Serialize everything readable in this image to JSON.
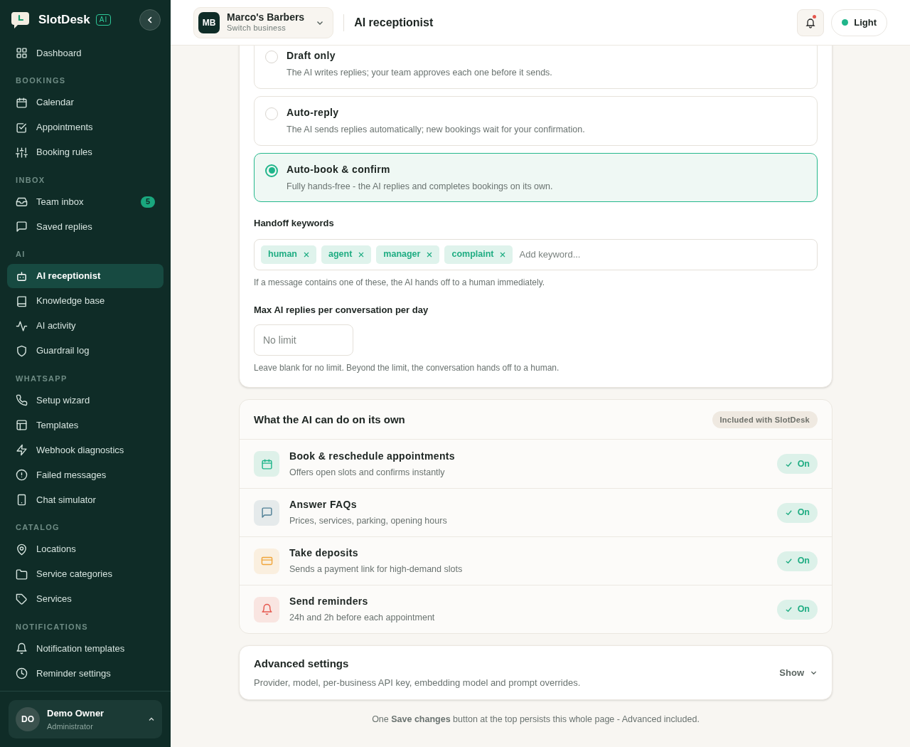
{
  "brand": {
    "name": "SlotDesk",
    "badge": "AI"
  },
  "sidebar": {
    "items": [
      {
        "label": "Dashboard",
        "kind": "grid",
        "selected": false
      }
    ],
    "sections": [
      {
        "title": "BOOKINGS",
        "items": [
          {
            "label": "Calendar",
            "kind": "calendar",
            "selected": false
          },
          {
            "label": "Appointments",
            "kind": "check",
            "selected": false
          },
          {
            "label": "Booking rules",
            "kind": "sliders",
            "selected": false
          }
        ]
      },
      {
        "title": "INBOX",
        "items": [
          {
            "label": "Team inbox",
            "kind": "inbox",
            "selected": false,
            "badge": "5"
          },
          {
            "label": "Saved replies",
            "kind": "chat",
            "selected": false
          }
        ]
      },
      {
        "title": "AI",
        "items": [
          {
            "label": "AI receptionist",
            "kind": "bot",
            "selected": true
          },
          {
            "label": "Knowledge base",
            "kind": "book",
            "selected": false
          },
          {
            "label": "AI activity",
            "kind": "pulse",
            "selected": false
          },
          {
            "label": "Guardrail log",
            "kind": "shield",
            "selected": false
          }
        ]
      },
      {
        "title": "WHATSAPP",
        "items": [
          {
            "label": "Setup wizard",
            "kind": "phone",
            "selected": false
          },
          {
            "label": "Templates",
            "kind": "layout",
            "selected": false
          },
          {
            "label": "Webhook diagnostics",
            "kind": "bolt",
            "selected": false
          },
          {
            "label": "Failed messages",
            "kind": "alert",
            "selected": false
          },
          {
            "label": "Chat simulator",
            "kind": "mobile",
            "selected": false
          }
        ]
      },
      {
        "title": "CATALOG",
        "items": [
          {
            "label": "Locations",
            "kind": "pin",
            "selected": false
          },
          {
            "label": "Service categories",
            "kind": "folder",
            "selected": false
          },
          {
            "label": "Services",
            "kind": "tag",
            "selected": false
          }
        ]
      },
      {
        "title": "NOTIFICATIONS",
        "items": [
          {
            "label": "Notification templates",
            "kind": "bell",
            "selected": false
          },
          {
            "label": "Reminder settings",
            "kind": "clock",
            "selected": false
          }
        ]
      }
    ],
    "user": {
      "initials": "DO",
      "name": "Demo Owner",
      "role": "Administrator"
    }
  },
  "header": {
    "business": {
      "initials": "MB",
      "name": "Marco's Barbers",
      "subtitle": "Switch business"
    },
    "title": "AI receptionist",
    "notifications_unread": true,
    "theme": "Light"
  },
  "modes": [
    {
      "title": "Draft only",
      "description": "The AI writes replies; your team approves each one before it sends.",
      "selected": false
    },
    {
      "title": "Auto-reply",
      "description": "The AI sends replies automatically; new bookings wait for your confirmation.",
      "selected": false
    },
    {
      "title": "Auto-book & confirm",
      "description": "Fully hands-free - the AI replies and completes bookings on its own.",
      "selected": true
    }
  ],
  "handoff": {
    "label": "Handoff keywords",
    "keywords": [
      "human",
      "agent",
      "manager",
      "complaint"
    ],
    "placeholder": "Add keyword...",
    "help": "If a message contains one of these, the AI hands off to a human immediately."
  },
  "max_replies": {
    "label": "Max AI replies per conversation per day",
    "placeholder": "No limit",
    "help": "Leave blank for no limit. Beyond the limit, the conversation hands off to a human."
  },
  "capabilities": {
    "title": "What the AI can do on its own",
    "badge": "Included with SlotDesk",
    "items": [
      {
        "kind": "calendar",
        "color": "#1fb58a",
        "title": "Book & reschedule appointments",
        "description": "Offers open slots and confirms instantly",
        "on": true,
        "status": "On"
      },
      {
        "kind": "chat",
        "color": "#4f7f95",
        "title": "Answer FAQs",
        "description": "Prices, services, parking, opening hours",
        "on": true,
        "status": "On"
      },
      {
        "kind": "card",
        "color": "#f0a53a",
        "title": "Take deposits",
        "description": "Sends a payment link for high-demand slots",
        "on": true,
        "status": "On"
      },
      {
        "kind": "bell",
        "color": "#e5574d",
        "title": "Send reminders",
        "description": "24h and 2h before each appointment",
        "on": true,
        "status": "On"
      }
    ]
  },
  "advanced": {
    "title": "Advanced settings",
    "description": "Provider, model, per-business API key, embedding model and prompt overrides.",
    "toggle": "Show",
    "expanded": false
  },
  "footer_note": "One **Save changes** button at the top persists this whole page - Advanced included."
}
